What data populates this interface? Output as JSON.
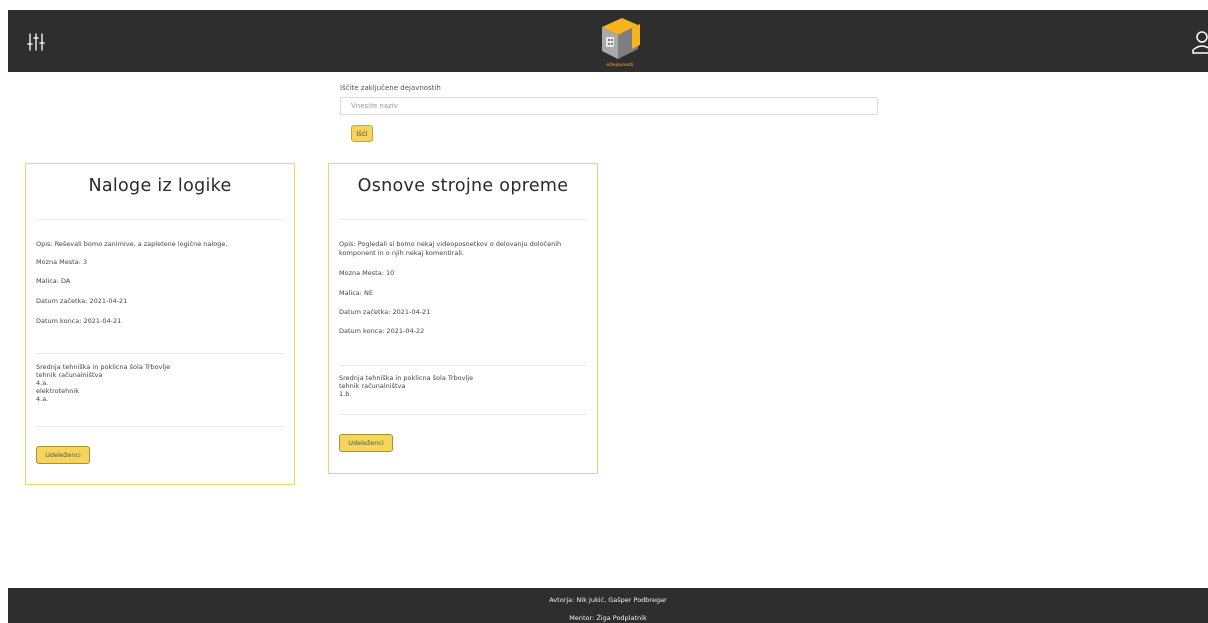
{
  "navbar": {
    "filter_icon": "sliders-icon",
    "logo_text": "eDejavnosti",
    "user_icon": "user-icon",
    "colors": {
      "background": "#2e2e2e",
      "accent": "#f6d55c"
    }
  },
  "search": {
    "label": "Iščite zaključene dejavnostih",
    "placeholder": "Vnesite naziv",
    "value": "",
    "button_label": "Išči"
  },
  "cards": [
    {
      "title": "Naloge iz logike",
      "opis": "Opis: Reševali bomo zanimive, a zapletene logične naloge.",
      "mozna_mesta": "Mozna Mesta: 3",
      "malica": "Malica: DA",
      "datum_zacetka": "Datum začetka: 2021-04-21",
      "datum_konca": "Datum konca: 2021-04-21",
      "school_lines": [
        "Srednja tehniška in poklicna šola Trbovlje",
        "tehnik računalništva",
        "4.a.",
        "elektrotehnik",
        "4.a."
      ],
      "button_label": "Udeleženci"
    },
    {
      "title": "Osnove strojne opreme",
      "opis": "Opis: Pogledali si bomo nekaj videoposnetkov o delovanju določenih komponent in o njih nekaj komentirali.",
      "mozna_mesta": "Mozna Mesta: 10",
      "malica": "Malica: NE",
      "datum_zacetka": "Datum začetka: 2021-04-21",
      "datum_konca": "Datum konca: 2021-04-22",
      "school_lines": [
        "Srednja tehniška in poklicna šola Trbovlje",
        "tehnik računalništva",
        "1.b."
      ],
      "button_label": "Udeleženci"
    }
  ],
  "footer": {
    "authors": "Avtorja: Nik Jukić, Gašper Podbregar",
    "mentor": "Mentor: Žiga Podplatnik"
  }
}
